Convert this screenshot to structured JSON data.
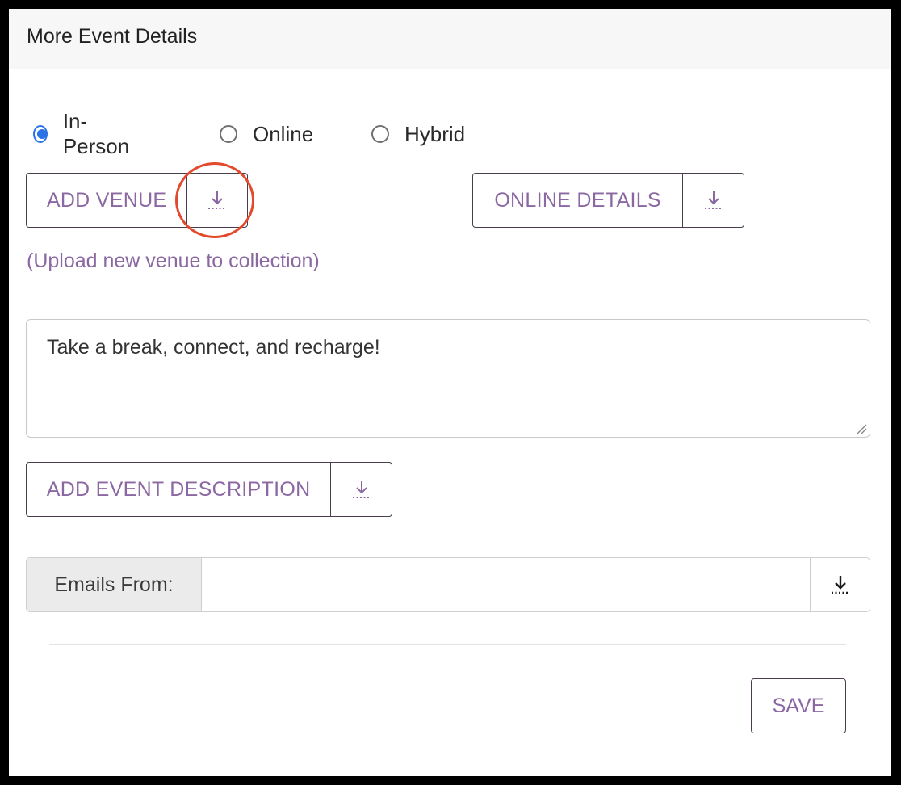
{
  "header": {
    "title": "More Event Details"
  },
  "event_type": {
    "options": [
      {
        "label": "In-Person",
        "checked": true
      },
      {
        "label": "Online",
        "checked": false
      },
      {
        "label": "Hybrid",
        "checked": false
      }
    ]
  },
  "venue": {
    "button_label": "ADD VENUE",
    "icon": "download-icon",
    "note": "(Upload new venue to collection)"
  },
  "online": {
    "button_label": "ONLINE DETAILS",
    "icon": "download-icon"
  },
  "description": {
    "text": "Take a break, connect, and recharge!",
    "button_label": "ADD EVENT DESCRIPTION",
    "icon": "download-icon"
  },
  "emails": {
    "label": "Emails From:",
    "value": "",
    "icon": "download-icon"
  },
  "footer": {
    "save_label": "SAVE"
  },
  "colors": {
    "accent_purple": "#8c68a3",
    "radio_blue": "#2a73e6",
    "highlight_red": "#e3492d",
    "border_dark": "#4a3d4e"
  }
}
